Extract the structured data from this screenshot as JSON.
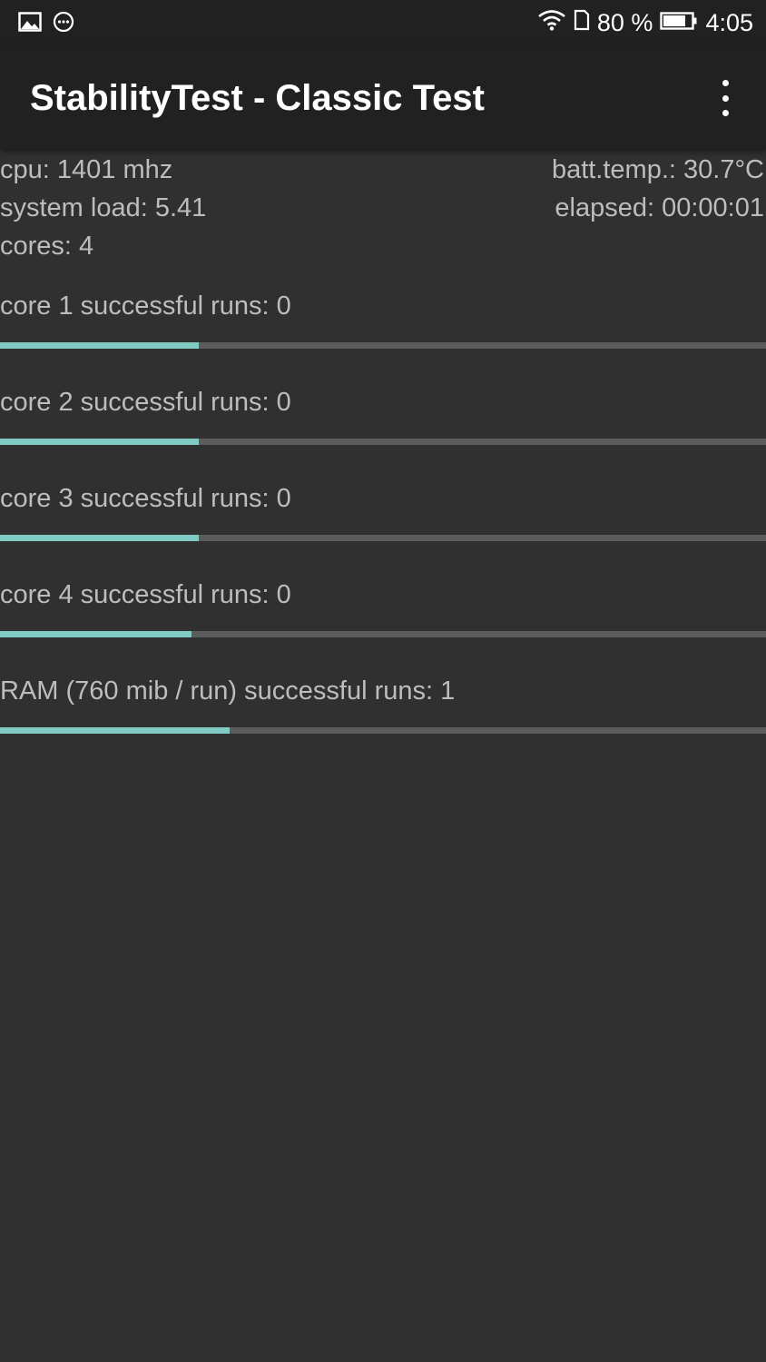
{
  "status_bar": {
    "icons_left": [
      "image-icon",
      "messenger-icon"
    ],
    "battery_percent_label": "80 %",
    "time": "4:05",
    "battery_level": 0.8
  },
  "app_bar": {
    "title": "StabilityTest - Classic Test",
    "menu_icon": "more-vert-icon"
  },
  "stats": {
    "cpu": "cpu: 1401 mhz",
    "batt_temp": "batt.temp.: 30.7°C",
    "system_load": "system load: 5.41",
    "elapsed": "elapsed: 00:00:01",
    "cores": "cores: 4"
  },
  "tests": [
    {
      "label": "core 1 successful runs: 0",
      "progress": 0.26
    },
    {
      "label": "core 2 successful runs: 0",
      "progress": 0.26
    },
    {
      "label": "core 3 successful runs: 0",
      "progress": 0.26
    },
    {
      "label": "core 4 successful runs: 0",
      "progress": 0.25
    },
    {
      "label": "RAM (760 mib / run) successful runs: 1",
      "progress": 0.3
    }
  ],
  "colors": {
    "background": "#303030",
    "app_bar": "#212121",
    "accent": "#80cbc4",
    "track": "#5c5c5c",
    "text": "#bdbdbd"
  }
}
